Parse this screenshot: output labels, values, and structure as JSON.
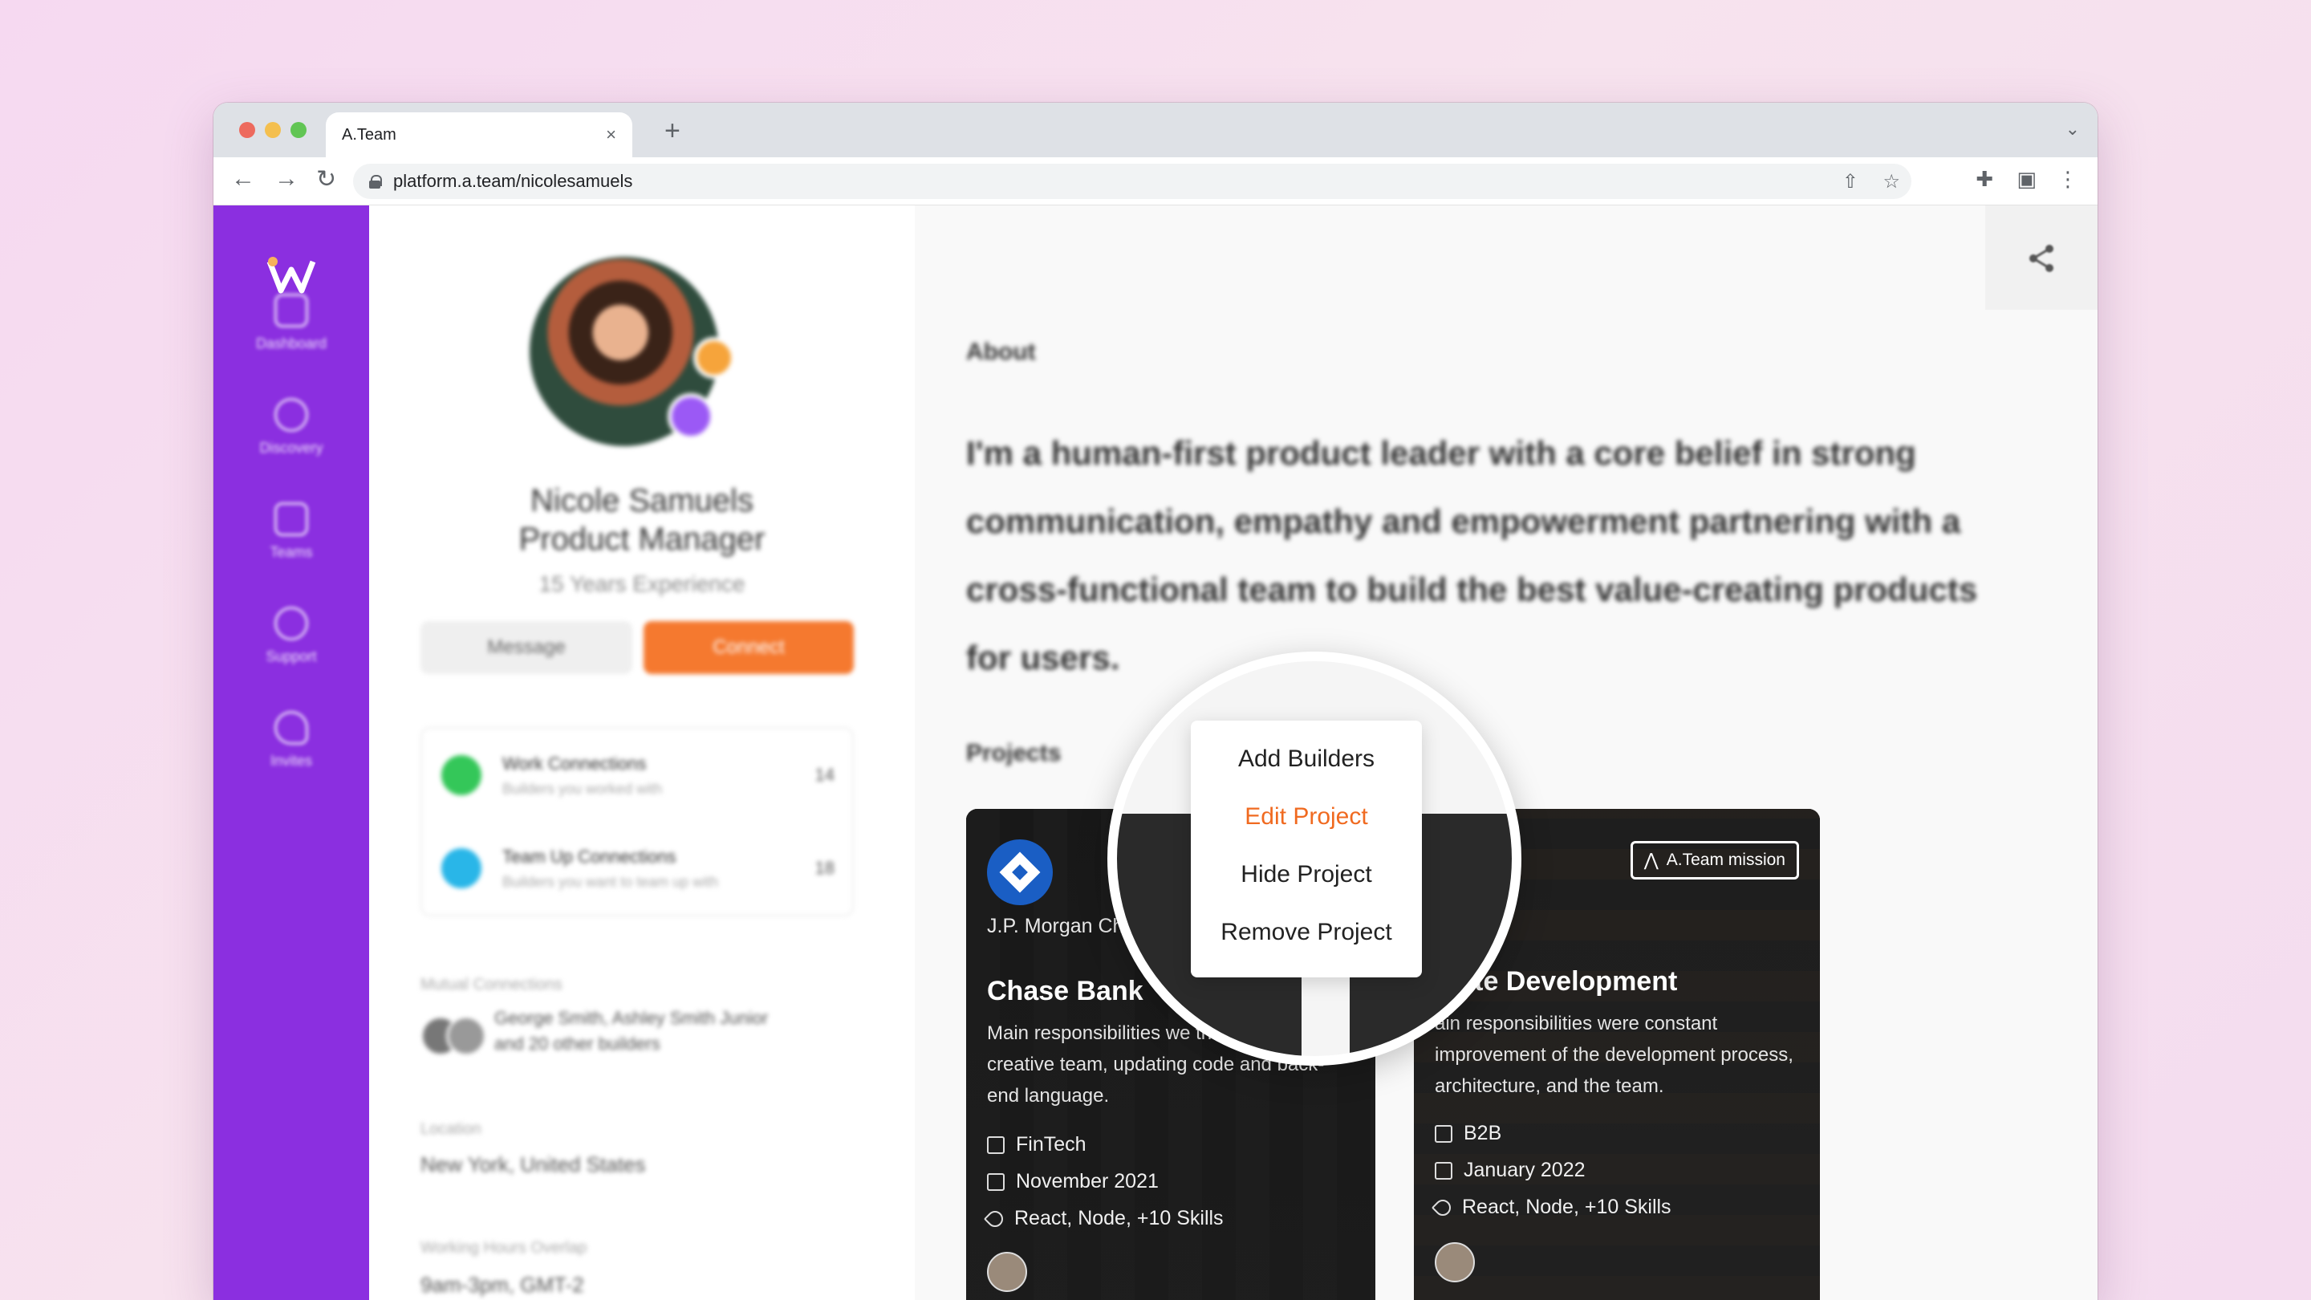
{
  "browser": {
    "tab_title": "A.Team",
    "tab_close": "×",
    "new_tab": "+",
    "tab_menu": "⌄",
    "url": "platform.a.team/nicolesamuels",
    "nav": {
      "back": "←",
      "forward": "→",
      "reload": "↻"
    },
    "toolbar_icons": {
      "share": "⇧",
      "bookmark": "☆",
      "extensions": "✚",
      "sidebar": "▣",
      "menu": "⋮"
    }
  },
  "sidebar": {
    "items": [
      {
        "label": "Dashboard",
        "icon": "dashboard-icon"
      },
      {
        "label": "Discovery",
        "icon": "compass-icon"
      },
      {
        "label": "Teams",
        "icon": "teams-icon"
      },
      {
        "label": "Support",
        "icon": "support-icon"
      },
      {
        "label": "Invites",
        "icon": "key-icon"
      }
    ]
  },
  "profile": {
    "name": "Nicole Samuels",
    "role": "Product Manager",
    "experience": "15 Years Experience",
    "message_label": "Message",
    "connect_label": "Connect",
    "connections": [
      {
        "title": "Work Connections",
        "subtitle": "Builders you worked with",
        "count": "14",
        "color": "#34c759"
      },
      {
        "title": "Team Up Connections",
        "subtitle": "Builders you want to team up with",
        "count": "18",
        "color": "#29b6e8"
      }
    ],
    "mutual_label": "Mutual Connections",
    "mutual_text_1": "George Smith, Ashley Smith Junior",
    "mutual_text_2": "and 20 other builders",
    "location_label": "Location",
    "location_value": "New York, United States",
    "hours_label": "Working Hours Overlap",
    "hours_value": "9am-3pm, GMT-2"
  },
  "about": {
    "title": "About",
    "text": "I'm a human-first product leader with a core belief in strong communication, empathy and empowerment partnering with a cross-functional team to build the best value-creating products for users."
  },
  "projects": {
    "title": "Projects",
    "cards": [
      {
        "company": "J.P. Morgan Ch",
        "title": "Chase Bank",
        "description": "Main responsibilities we the dev and creative team, updating code and back-end language.",
        "industry": "FinTech",
        "date": "November 2021",
        "skills": "React, Node, +10 Skills"
      },
      {
        "badge": "A.Team mission",
        "title": "osite Development",
        "description": "ain responsibilities were constant improvement of the development process, architecture, and the team.",
        "industry": "B2B",
        "date": "January 2022",
        "skills": "React, Node, +10 Skills"
      }
    ]
  },
  "context_menu": {
    "items": [
      "Add Builders",
      "Edit Project",
      "Hide Project",
      "Remove Project"
    ],
    "active_index": 1,
    "active_color": "#f06a20"
  },
  "colors": {
    "sidebar": "#8b2fe0",
    "connect": "#f5792f",
    "accent": "#f06a20"
  }
}
